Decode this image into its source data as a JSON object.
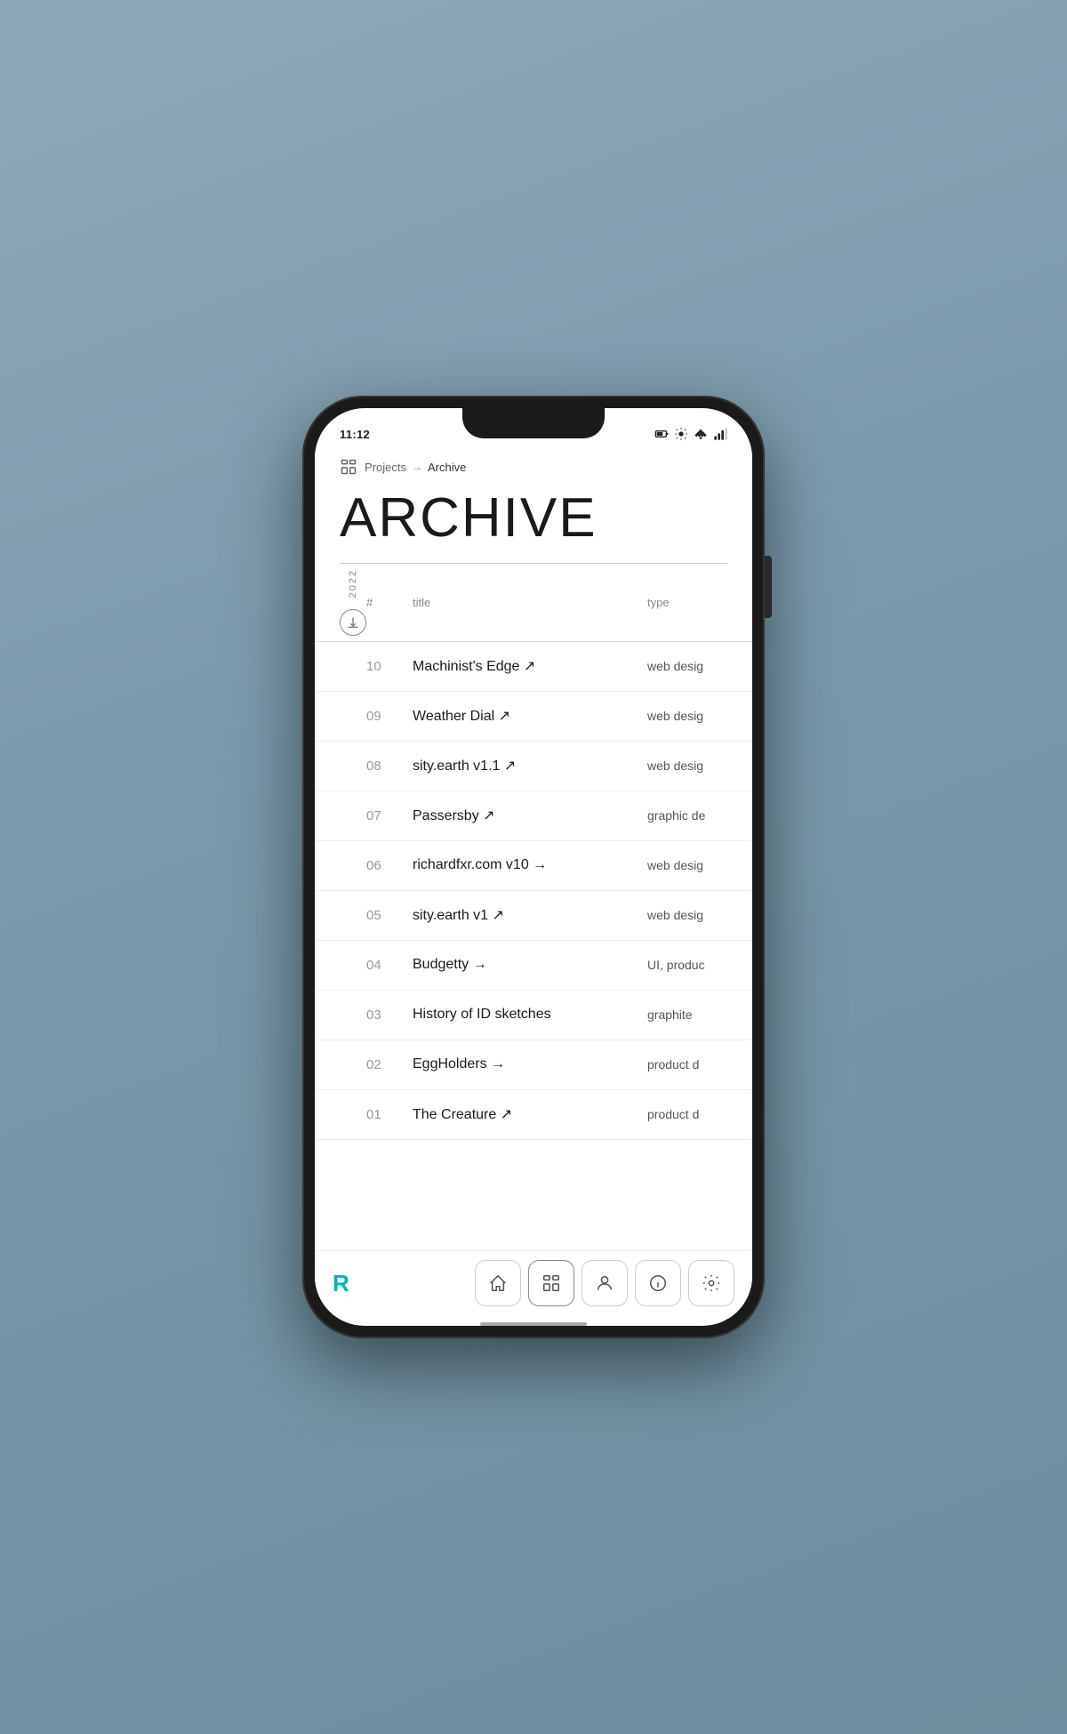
{
  "status_bar": {
    "time": "11:12",
    "battery_icon": "battery",
    "settings_icon": "settings",
    "wifi_icon": "wifi",
    "signal_icon": "signal"
  },
  "breadcrumb": {
    "icon": "grid",
    "parent": "Projects",
    "arrow": "→",
    "current": "Archive"
  },
  "page": {
    "title": "ARCHIVE",
    "year": "2022"
  },
  "table": {
    "columns": {
      "num": "#",
      "title": "title",
      "type": "type"
    },
    "rows": [
      {
        "num": "10",
        "title": "Machinist's Edge ↗",
        "type": "web desig"
      },
      {
        "num": "09",
        "title": "Weather Dial ↗",
        "type": "web desig"
      },
      {
        "num": "08",
        "title": "sity.earth v1.1 ↗",
        "type": "web desig"
      },
      {
        "num": "07",
        "title": "Passersby ↗",
        "type": "graphic de"
      },
      {
        "num": "06",
        "title": "richardfxr.com v10 →",
        "type": "web desig"
      },
      {
        "num": "05",
        "title": "sity.earth v1 ↗",
        "type": "web desig"
      },
      {
        "num": "04",
        "title": "Budgetty →",
        "type": "UI, produc"
      },
      {
        "num": "03",
        "title": "History of ID sketches",
        "type": "graphite"
      },
      {
        "num": "02",
        "title": "EggHolders →",
        "type": "product d"
      },
      {
        "num": "01",
        "title": "The Creature ↗",
        "type": "product d"
      }
    ]
  },
  "nav": {
    "logo": "R",
    "buttons": [
      {
        "icon": "home",
        "label": "home",
        "active": false
      },
      {
        "icon": "grid",
        "label": "projects",
        "active": true
      },
      {
        "icon": "person",
        "label": "profile",
        "active": false
      },
      {
        "icon": "info",
        "label": "info",
        "active": false
      },
      {
        "icon": "settings",
        "label": "settings",
        "active": false
      }
    ]
  },
  "colors": {
    "teal": "#00b5b5",
    "text_primary": "#1a1a1a",
    "text_secondary": "#888",
    "border": "#ddd"
  }
}
